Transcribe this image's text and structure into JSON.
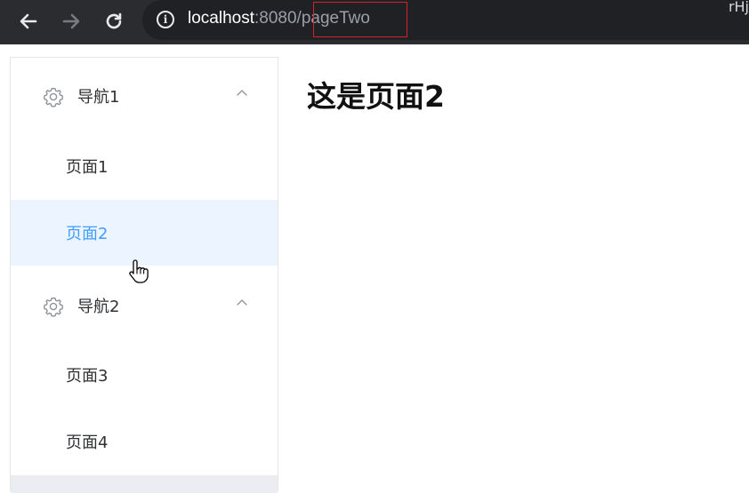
{
  "browser": {
    "url_host": "localhost",
    "url_port": ":8080",
    "url_path": "/pageTwo",
    "corner_text": "rHj",
    "icons": {
      "back": "arrow-left-icon",
      "forward": "arrow-right-icon",
      "reload": "reload-icon",
      "info": "info-icon"
    }
  },
  "sidebar": {
    "groups": [
      {
        "title": "导航1",
        "icon": "gear-icon",
        "items": [
          {
            "label": "页面1",
            "active": false
          },
          {
            "label": "页面2",
            "active": true
          }
        ]
      },
      {
        "title": "导航2",
        "icon": "gear-icon",
        "items": [
          {
            "label": "页面3",
            "active": false
          },
          {
            "label": "页面4",
            "active": false
          }
        ]
      }
    ]
  },
  "main": {
    "title": "这是页面2"
  },
  "colors": {
    "active_text": "#409eff",
    "active_bg": "#ecf5ff",
    "highlight_box": "#d2242a",
    "browser_bg": "#2b2c30"
  }
}
